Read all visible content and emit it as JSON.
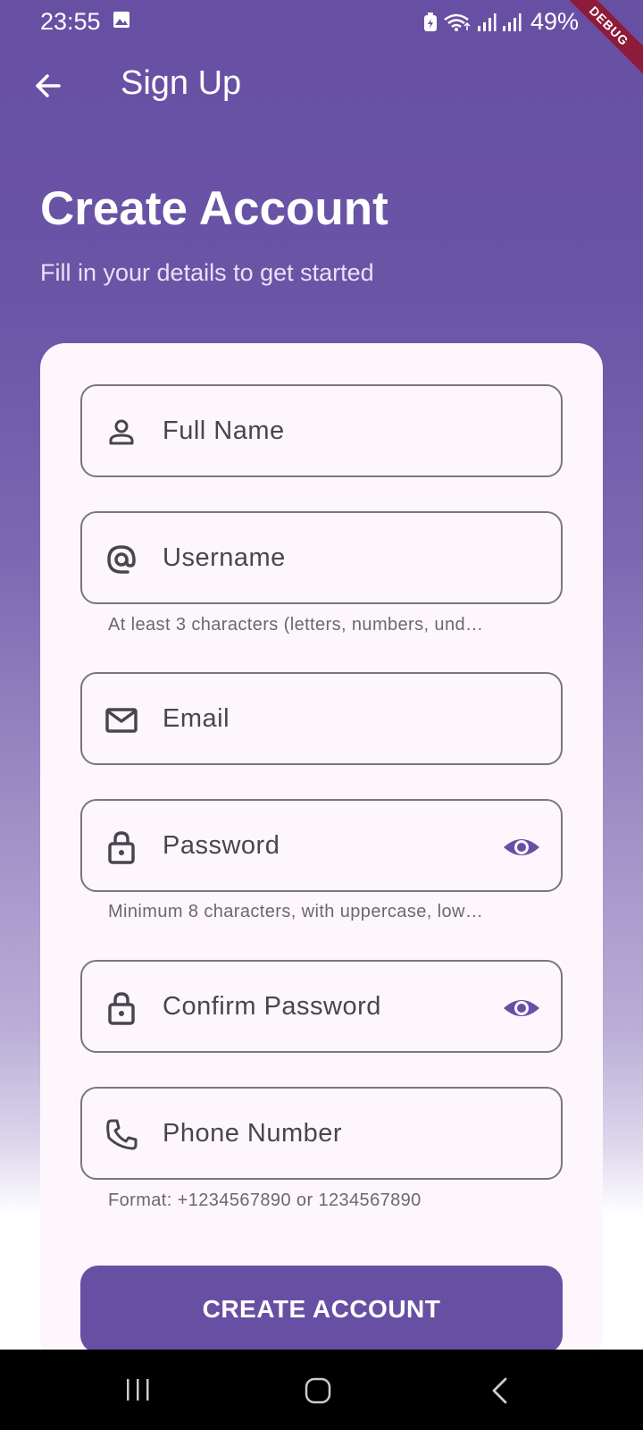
{
  "status": {
    "time": "23:55",
    "battery": "49%",
    "debug": "DEBUG"
  },
  "appbar": {
    "title": "Sign Up",
    "back_icon": "arrow-back-icon"
  },
  "hero": {
    "title": "Create Account",
    "subtitle": "Fill in your details to get started"
  },
  "form": {
    "full_name": {
      "label": "Full Name",
      "icon": "person-icon"
    },
    "username": {
      "label": "Username",
      "icon": "at-icon",
      "helper": "At least 3 characters (letters, numbers, und…"
    },
    "email": {
      "label": "Email",
      "icon": "mail-icon"
    },
    "password": {
      "label": "Password",
      "icon": "lock-icon",
      "helper": "Minimum 8 characters, with uppercase, low…"
    },
    "confirm_password": {
      "label": "Confirm Password",
      "icon": "lock-icon"
    },
    "phone": {
      "label": "Phone Number",
      "icon": "phone-icon",
      "helper": "Format: +1234567890 or 1234567890"
    },
    "submit_label": "CREATE ACCOUNT"
  },
  "colors": {
    "primary": "#6750a4",
    "card": "#fdf7fd",
    "outline": "#7a757f"
  }
}
